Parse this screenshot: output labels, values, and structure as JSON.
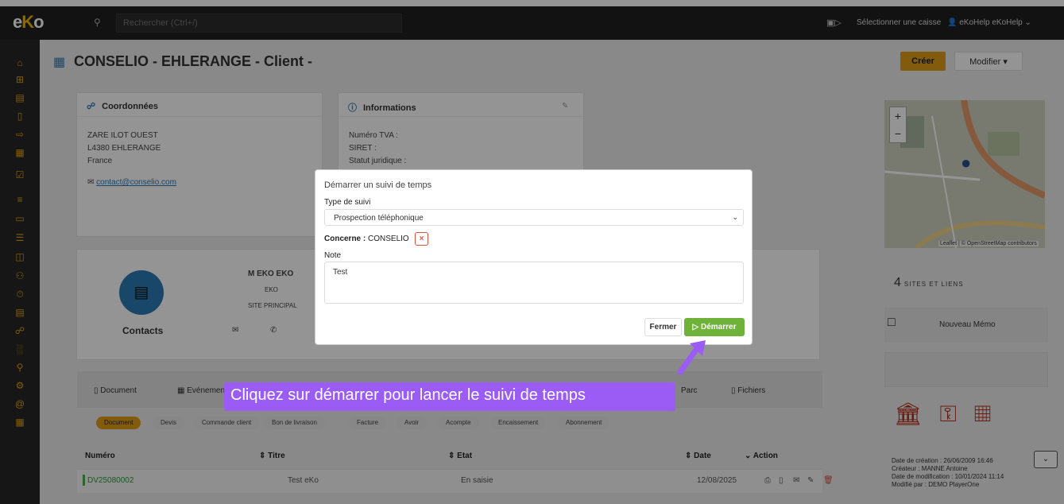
{
  "topbar": {
    "logo": "eKo",
    "search_placeholder": "Rechercher (Ctrl+/)",
    "caisse": "Sélectionner une caisse",
    "user": "eKoHelp eKoHelp"
  },
  "page": {
    "title": "CONSELIO - EHLERANGE - Client -",
    "create_button": "Créer",
    "modify_button": "Modifier"
  },
  "coordonnees": {
    "title": "Coordonnées",
    "lines": [
      "ZARE ILOT OUEST",
      "L4380 EHLERANGE",
      "France"
    ],
    "email": "contact@conselio.com"
  },
  "informations": {
    "title": "Informations",
    "lines": [
      "Numéro TVA :",
      "SIRET :",
      "Statut juridique :"
    ]
  },
  "contacts": {
    "label": "Contacts",
    "person": "M EKO EKO",
    "company": "EKO",
    "site": "SITE PRINCIPAL"
  },
  "tabs": {
    "items": [
      "Document",
      "Evénemen",
      "Parc",
      "Fichiers"
    ]
  },
  "subtabs": [
    "Document",
    "Devis",
    "Commande client",
    "Bon de livraison",
    "Facture",
    "Avoir",
    "Acompte",
    "Encaissement",
    "Abonnement"
  ],
  "table": {
    "headers": [
      "Numéro",
      "Titre",
      "Etat",
      "Date",
      "Action"
    ],
    "rows": [
      {
        "numero": "DV25080002",
        "titre": "Test eKo",
        "etat": "En saisie",
        "date": "12/08/2025"
      }
    ]
  },
  "right": {
    "sites_count": "4",
    "sites_label": "SITES ET LIENS",
    "memo": "Nouveau Mémo",
    "map_credit": "Leaflet | © OpenStreetMap contributors",
    "meta": [
      "Date de création : 26/06/2009 16:46",
      "Créateur : MANNE Antoine",
      "Date de modification : 10/01/2024 11:14",
      "Modifié par : DEMO PlayerOne"
    ]
  },
  "modal": {
    "title": "Démarrer un suivi de temps",
    "type_label": "Type de suivi",
    "type_value": "Prospection téléphonique",
    "concerne_label": "Concerne :",
    "concerne_value": "CONSELIO",
    "note_label": "Note",
    "note_value": "Test",
    "close_button": "Fermer",
    "start_button": "Démarrer"
  },
  "tooltip": "Cliquez sur démarrer pour lancer le suivi de temps",
  "colors": {
    "accent": "#e09d18",
    "primary": "#2f7ab7",
    "success": "#6fb23a",
    "tooltip": "#9b5cf6"
  }
}
